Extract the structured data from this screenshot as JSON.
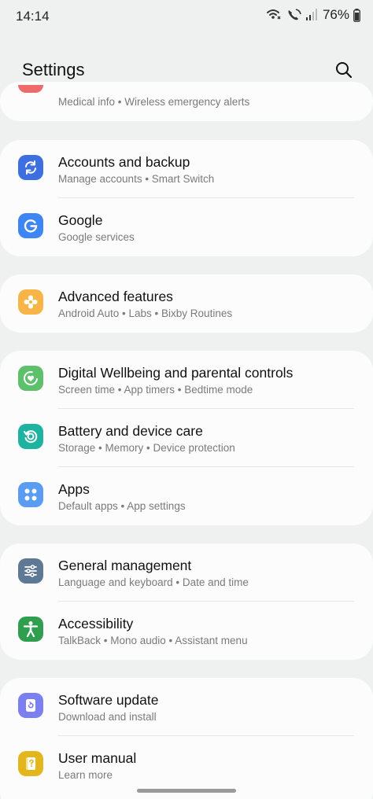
{
  "status": {
    "time": "14:14",
    "battery": "76%"
  },
  "header": {
    "title": "Settings"
  },
  "partial_item": {
    "subtitle": "Medical info  •  Wireless emergency alerts",
    "color": "#ef6b6b"
  },
  "groups": [
    {
      "items": [
        {
          "title": "Accounts and backup",
          "subtitle": "Manage accounts  •  Smart Switch",
          "icon": "sync-icon",
          "color": "#3d6fe0"
        },
        {
          "title": "Google",
          "subtitle": "Google services",
          "icon": "google-icon",
          "color": "#3f86f5"
        }
      ]
    },
    {
      "items": [
        {
          "title": "Advanced features",
          "subtitle": "Android Auto  •  Labs  •  Bixby Routines",
          "icon": "advanced-features-icon",
          "color": "#f7b548"
        }
      ]
    },
    {
      "items": [
        {
          "title": "Digital Wellbeing and parental controls",
          "subtitle": "Screen time  •  App timers  •  Bedtime mode",
          "icon": "wellbeing-icon",
          "color": "#5dc06a"
        },
        {
          "title": "Battery and device care",
          "subtitle": "Storage  •  Memory  •  Device protection",
          "icon": "device-care-icon",
          "color": "#1eb2a0"
        },
        {
          "title": "Apps",
          "subtitle": "Default apps  •  App settings",
          "icon": "apps-icon",
          "color": "#5a9cf2"
        }
      ]
    },
    {
      "items": [
        {
          "title": "General management",
          "subtitle": "Language and keyboard  •  Date and time",
          "icon": "sliders-icon",
          "color": "#5f7894"
        },
        {
          "title": "Accessibility",
          "subtitle": "TalkBack  •  Mono audio  •  Assistant menu",
          "icon": "accessibility-icon",
          "color": "#2f9e4e"
        }
      ]
    },
    {
      "items": [
        {
          "title": "Software update",
          "subtitle": "Download and install",
          "icon": "software-update-icon",
          "color": "#7c7ff0"
        },
        {
          "title": "User manual",
          "subtitle": "Learn more",
          "icon": "user-manual-icon",
          "color": "#e3b71c"
        }
      ]
    }
  ]
}
